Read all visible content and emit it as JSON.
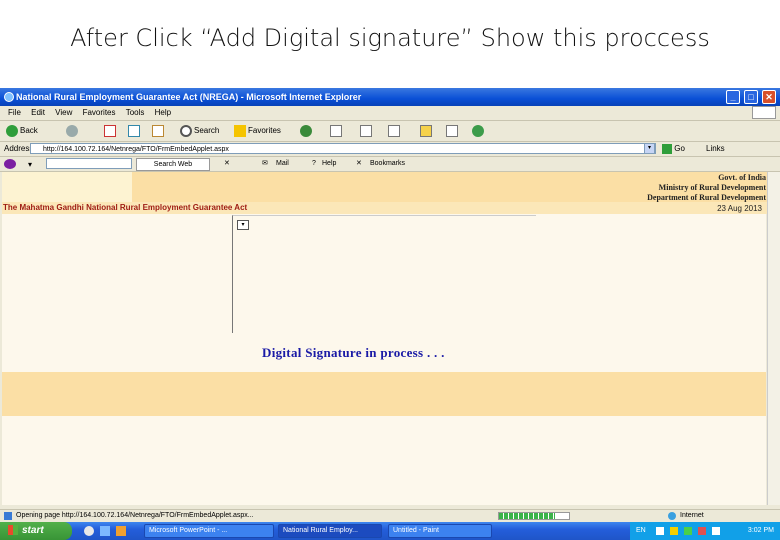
{
  "slide": {
    "title": "After Click “Add Digital signature” Show this proccess"
  },
  "window": {
    "title": "National Rural Employment Guarantee Act (NREGA) - Microsoft Internet Explorer",
    "minimize": "_",
    "maximize": "□",
    "close": "✕"
  },
  "menubar": {
    "items": [
      "File",
      "Edit",
      "View",
      "Favorites",
      "Tools",
      "Help"
    ]
  },
  "toolbar": {
    "back": "Back",
    "search": "Search",
    "favorites": "Favorites"
  },
  "addressbar": {
    "label": "Address",
    "url": "http://164.100.72.164/Netnrega/FTO/FrmEmbedApplet.aspx",
    "go": "Go",
    "links": "Links"
  },
  "yahoobar": {
    "search_button": "Search Web",
    "mail": "Mail",
    "help": "Help",
    "bookmarks": "Bookmarks"
  },
  "page": {
    "govt_lines": [
      "Govt. of India",
      "Ministry of Rural Development",
      "Department of Rural Development"
    ],
    "scheme": "The Mahatma Gandhi National Rural Employment Guarantee Act",
    "date": "23 Aug 2013",
    "status_message": "Digital Signature in process . . ."
  },
  "statusbar": {
    "text": "Opening page http://164.100.72.164/Netnrega/FTO/FrmEmbedApplet.aspx...",
    "zone": "Internet",
    "progress_fraction": 0.8
  },
  "taskbar": {
    "start": "start",
    "tasks": [
      "Microsoft PowerPoint - ...",
      "National Rural Employ...",
      "Untitled - Paint"
    ],
    "lang": "EN",
    "clock": "3:02 PM"
  }
}
